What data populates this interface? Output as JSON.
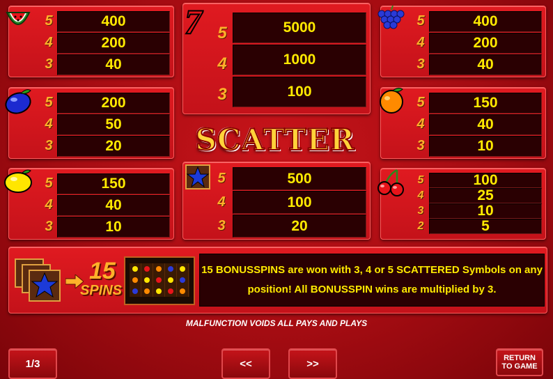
{
  "paytable": {
    "watermelon": {
      "icon": "watermelon-icon",
      "rows": [
        {
          "mult": "5",
          "val": "400"
        },
        {
          "mult": "4",
          "val": "200"
        },
        {
          "mult": "3",
          "val": "40"
        }
      ]
    },
    "seven": {
      "icon": "seven-icon",
      "symbol": "7",
      "rows": [
        {
          "mult": "5",
          "val": "5000"
        },
        {
          "mult": "4",
          "val": "1000"
        },
        {
          "mult": "3",
          "val": "100"
        }
      ]
    },
    "grapes": {
      "icon": "grapes-icon",
      "rows": [
        {
          "mult": "5",
          "val": "400"
        },
        {
          "mult": "4",
          "val": "200"
        },
        {
          "mult": "3",
          "val": "40"
        }
      ]
    },
    "plum": {
      "icon": "plum-icon",
      "rows": [
        {
          "mult": "5",
          "val": "200"
        },
        {
          "mult": "4",
          "val": "50"
        },
        {
          "mult": "3",
          "val": "20"
        }
      ]
    },
    "orange": {
      "icon": "orange-icon",
      "rows": [
        {
          "mult": "5",
          "val": "150"
        },
        {
          "mult": "4",
          "val": "40"
        },
        {
          "mult": "3",
          "val": "10"
        }
      ]
    },
    "lemon": {
      "icon": "lemon-icon",
      "rows": [
        {
          "mult": "5",
          "val": "150"
        },
        {
          "mult": "4",
          "val": "40"
        },
        {
          "mult": "3",
          "val": "10"
        }
      ]
    },
    "star": {
      "icon": "blue-star-icon",
      "rows": [
        {
          "mult": "5",
          "val": "500"
        },
        {
          "mult": "4",
          "val": "100"
        },
        {
          "mult": "3",
          "val": "20"
        }
      ]
    },
    "cherry": {
      "icon": "cherry-icon",
      "rows": [
        {
          "mult": "5",
          "val": "100"
        },
        {
          "mult": "4",
          "val": "25"
        },
        {
          "mult": "3",
          "val": "10"
        },
        {
          "mult": "2",
          "val": "5"
        }
      ]
    }
  },
  "scatter_title": "SCATTER",
  "bonus": {
    "spins_count": "15",
    "spins_label": "SPINS",
    "text": "15 BONUSSPINS are won with 3, 4 or 5 SCATTERED Symbols on any position! All BONUSSPIN wins are multiplied by 3."
  },
  "disclaimer": "MALFUNCTION VOIDS ALL PAYS AND PLAYS",
  "nav": {
    "page": "1/3",
    "prev": "<<",
    "next": ">>",
    "return": "RETURN TO GAME"
  },
  "colors": {
    "value_text": "#ffea00",
    "multiplier_text": "#ffb12a",
    "panel": "#d0161c"
  }
}
